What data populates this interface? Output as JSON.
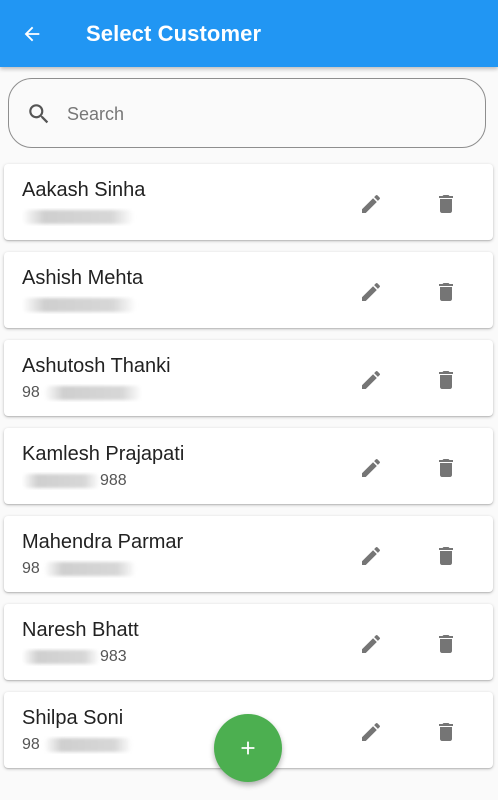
{
  "appbar": {
    "title": "Select Customer",
    "color": "#2196f3"
  },
  "search": {
    "placeholder": "Search",
    "value": ""
  },
  "customers": [
    {
      "name": "Aakash Sinha",
      "phone_visible": ""
    },
    {
      "name": "Ashish Mehta",
      "phone_visible": ""
    },
    {
      "name": "Ashutosh Thanki",
      "phone_visible": "98"
    },
    {
      "name": "Kamlesh Prajapati",
      "phone_visible": "988"
    },
    {
      "name": "Mahendra Parmar",
      "phone_visible": "98"
    },
    {
      "name": "Naresh Bhatt",
      "phone_visible": "983"
    },
    {
      "name": "Shilpa Soni",
      "phone_visible": "98"
    }
  ],
  "icons": {
    "back": "arrow-back-icon",
    "search": "search-icon",
    "edit": "pencil-icon",
    "delete": "trash-icon",
    "add": "plus-icon"
  },
  "fab": {
    "label": "+",
    "color": "#4caf50"
  }
}
